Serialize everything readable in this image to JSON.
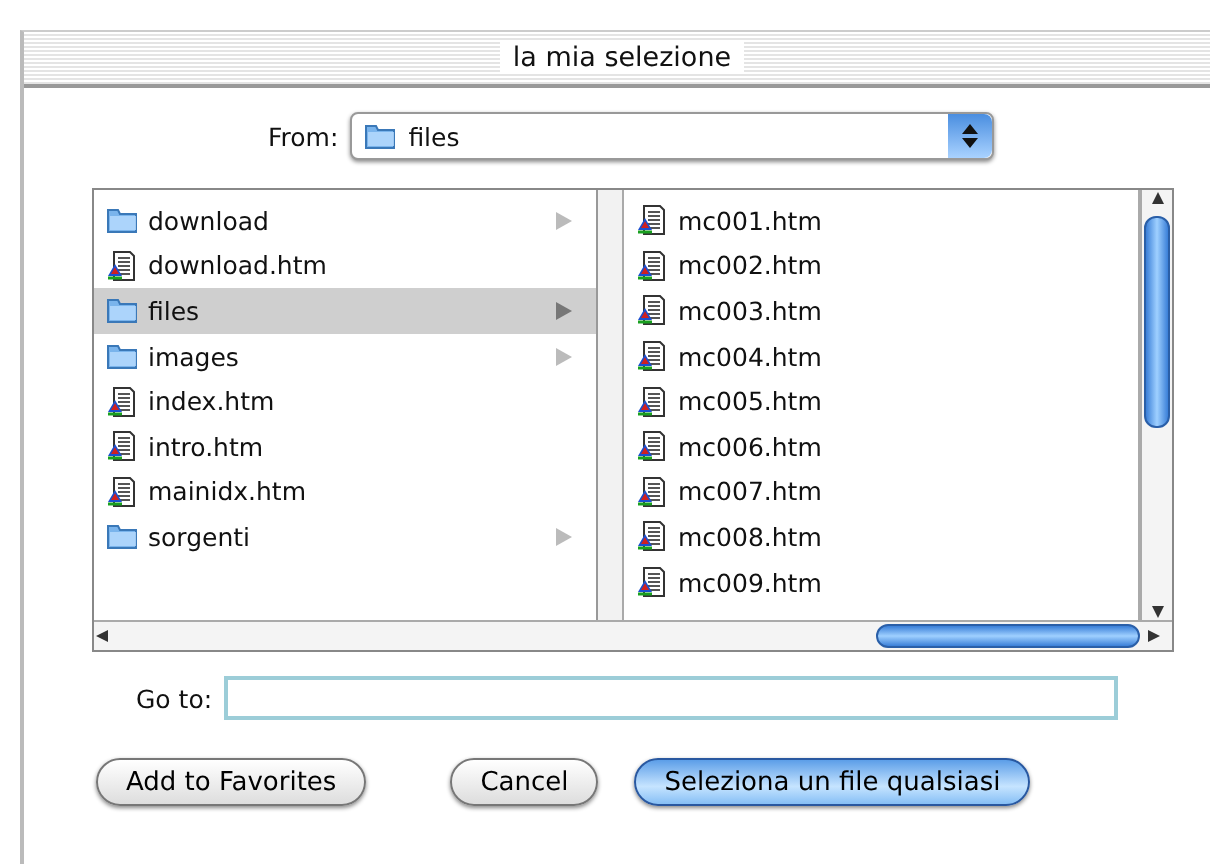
{
  "window": {
    "title": "la mia selezione"
  },
  "from": {
    "label": "From:",
    "value": "files"
  },
  "columns": [
    {
      "items": [
        {
          "name": "download",
          "kind": "folder",
          "selected": false
        },
        {
          "name": "download.htm",
          "kind": "file",
          "selected": false
        },
        {
          "name": "files",
          "kind": "folder",
          "selected": true
        },
        {
          "name": "images",
          "kind": "folder",
          "selected": false
        },
        {
          "name": "index.htm",
          "kind": "file",
          "selected": false
        },
        {
          "name": "intro.htm",
          "kind": "file",
          "selected": false
        },
        {
          "name": "mainidx.htm",
          "kind": "file",
          "selected": false
        },
        {
          "name": "sorgenti",
          "kind": "folder",
          "selected": false
        }
      ]
    },
    {
      "items": [
        {
          "name": "mc001.htm",
          "kind": "file",
          "selected": false
        },
        {
          "name": "mc002.htm",
          "kind": "file",
          "selected": false
        },
        {
          "name": "mc003.htm",
          "kind": "file",
          "selected": false
        },
        {
          "name": "mc004.htm",
          "kind": "file",
          "selected": false
        },
        {
          "name": "mc005.htm",
          "kind": "file",
          "selected": false
        },
        {
          "name": "mc006.htm",
          "kind": "file",
          "selected": false
        },
        {
          "name": "mc007.htm",
          "kind": "file",
          "selected": false
        },
        {
          "name": "mc008.htm",
          "kind": "file",
          "selected": false
        },
        {
          "name": "mc009.htm",
          "kind": "file",
          "selected": false
        }
      ]
    }
  ],
  "goto": {
    "label": "Go to:"
  },
  "buttons": [
    {
      "label": "Add to Favorites",
      "default": false
    },
    {
      "label": "Cancel",
      "default": false
    },
    {
      "label": "Seleziona un file qualsiasi",
      "default": true
    }
  ]
}
